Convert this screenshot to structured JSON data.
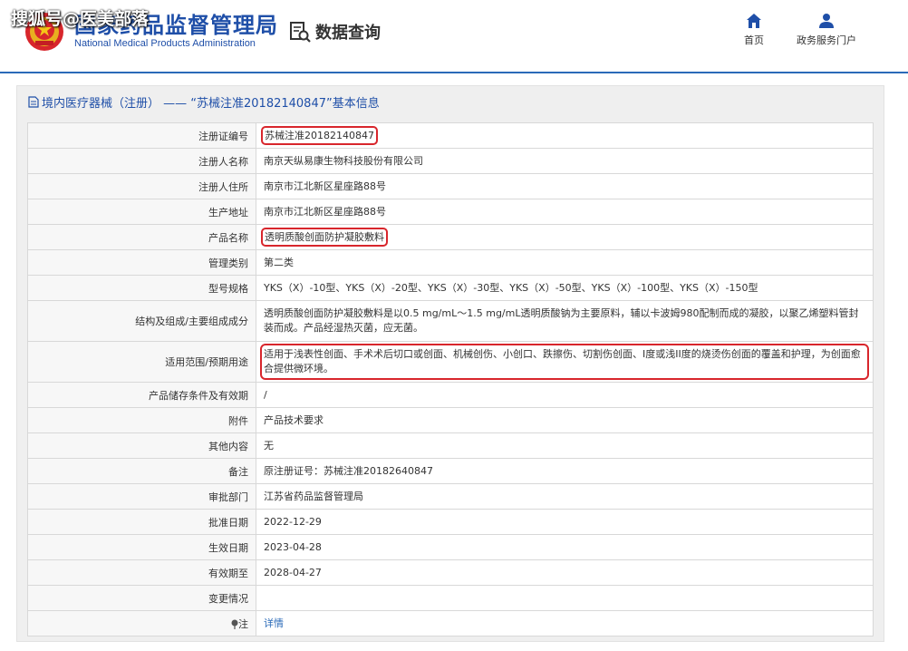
{
  "header": {
    "site_title": "国家药品监督管理局",
    "site_subtitle": "National Medical Products Administration",
    "watermark": "搜狐号@医美部落",
    "data_query": "数据查询",
    "nav": {
      "home": "首页",
      "portal": "政务服务门户"
    }
  },
  "panel": {
    "title": "境内医疗器械（注册） —— “苏械注准20182140847”基本信息"
  },
  "rows": {
    "reg_no": {
      "label": "注册证编号",
      "value": "苏械注准20182140847"
    },
    "registrant": {
      "label": "注册人名称",
      "value": "南京天纵易康生物科技股份有限公司"
    },
    "registrant_addr": {
      "label": "注册人住所",
      "value": "南京市江北新区星座路88号"
    },
    "production_addr": {
      "label": "生产地址",
      "value": "南京市江北新区星座路88号"
    },
    "product_name": {
      "label": "产品名称",
      "value": "透明质酸创面防护凝胶敷料"
    },
    "category": {
      "label": "管理类别",
      "value": "第二类"
    },
    "model": {
      "label": "型号规格",
      "value": "YKS（X）-10型、YKS（X）-20型、YKS（X）-30型、YKS（X）-50型、YKS（X）-100型、YKS（X）-150型"
    },
    "composition": {
      "label": "结构及组成/主要组成成分",
      "value": "透明质酸创面防护凝胶敷料是以0.5 mg/mL～1.5 mg/mL透明质酸钠为主要原料，辅以卡波姆980配制而成的凝胶，以聚乙烯塑料管封装而成。产品经湿热灭菌，应无菌。"
    },
    "scope": {
      "label": "适用范围/预期用途",
      "value": "适用于浅表性创面、手术术后切口或创面、机械创伤、小创口、跌擦伤、切割伤创面、I度或浅II度的烧烫伤创面的覆盖和护理，为创面愈合提供微环境。"
    },
    "storage": {
      "label": "产品储存条件及有效期",
      "value": "/"
    },
    "attachment": {
      "label": "附件",
      "value": "产品技术要求"
    },
    "other": {
      "label": "其他内容",
      "value": "无"
    },
    "remark": {
      "label": "备注",
      "value": "原注册证号：苏械注准20182640847"
    },
    "approval_dept": {
      "label": "审批部门",
      "value": "江苏省药品监督管理局"
    },
    "approval_date": {
      "label": "批准日期",
      "value": "2022-12-29"
    },
    "effective_date": {
      "label": "生效日期",
      "value": "2023-04-28"
    },
    "valid_until": {
      "label": "有效期至",
      "value": "2028-04-27"
    },
    "change": {
      "label": "变更情况",
      "value": ""
    },
    "note": {
      "label": "注",
      "value": "详情"
    }
  },
  "colors": {
    "brand_blue": "#1f4fa8",
    "link_blue": "#2a6ab8",
    "highlight_red": "#d8262c",
    "panel_bg": "#efefef",
    "label_bg": "#f7f7f7"
  }
}
